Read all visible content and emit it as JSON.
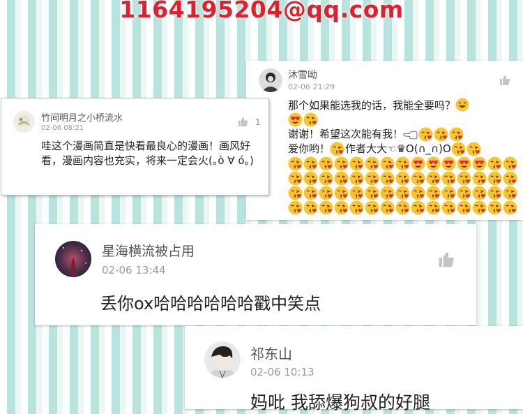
{
  "header": {
    "email": "1164195204@qq.com"
  },
  "comments": [
    {
      "username": "竹间明月之小桥流水",
      "time": "02-06 08:21",
      "text": "哇这个漫画简直是快看最良心的漫画！画风好看，漫画内容也充实，将来一定会火(｡ò ∀ ó｡)",
      "likes": "1"
    },
    {
      "username": "沐雪呦",
      "time": "02-06 21:29",
      "line1": "那个如果能选我的话，我能全要吗？",
      "line2": "谢谢！希望这次能有我！",
      "line3": "爱你哟！",
      "line3b": "作者大大☜♛O(∩_∩)O",
      "emoji_names": [
        "smile-emoji",
        "heart-eyes-emoji",
        "kissing-heart-emoji",
        "point-left-hand-emoji"
      ]
    },
    {
      "username": "星海横流被占用",
      "time": "02-06 13:44",
      "text": "丢你ox哈哈哈哈哈哈戳中笑点"
    },
    {
      "username": "祁东山",
      "time": "02-06 10:13",
      "text": "妈吡 我舔爆狗叔的好腿"
    }
  ]
}
